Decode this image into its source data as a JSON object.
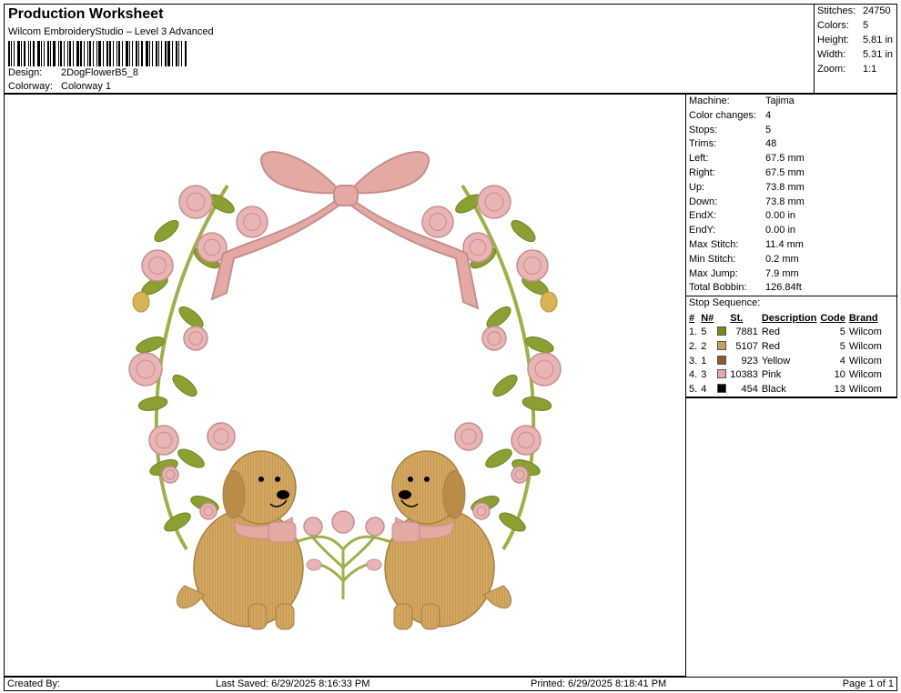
{
  "header": {
    "title": "Production Worksheet",
    "software": "Wilcom EmbroideryStudio – Level 3 Advanced",
    "design_label": "Design:",
    "design_value": "2DogFlowerB5_8",
    "colorway_label": "Colorway:",
    "colorway_value": "Colorway 1"
  },
  "stats": [
    {
      "label": "Stitches:",
      "value": "24750"
    },
    {
      "label": "Colors:",
      "value": "5"
    },
    {
      "label": "Height:",
      "value": "5.81 in"
    },
    {
      "label": "Width:",
      "value": "5.31 in"
    },
    {
      "label": "Zoom:",
      "value": "1:1"
    }
  ],
  "machine_info": [
    {
      "label": "Machine:",
      "value": "Tajima"
    },
    {
      "label": "Color changes:",
      "value": "4"
    },
    {
      "label": "Stops:",
      "value": "5"
    },
    {
      "label": "Trims:",
      "value": "48"
    },
    {
      "label": "Left:",
      "value": "67.5 mm"
    },
    {
      "label": "Right:",
      "value": "67.5 mm"
    },
    {
      "label": "Up:",
      "value": "73.8 mm"
    },
    {
      "label": "Down:",
      "value": "73.8 mm"
    },
    {
      "label": "EndX:",
      "value": "0.00 in"
    },
    {
      "label": "EndY:",
      "value": "0.00 in"
    },
    {
      "label": "Max Stitch:",
      "value": "11.4 mm"
    },
    {
      "label": "Min Stitch:",
      "value": "0.2 mm"
    },
    {
      "label": "Max Jump:",
      "value": "7.9 mm"
    },
    {
      "label": "Total Bobbin:",
      "value": "126.84ft"
    }
  ],
  "stop_sequence": {
    "title": "Stop Sequence:",
    "columns": [
      "#",
      "N#",
      "St.",
      "Description",
      "Code",
      "Brand"
    ],
    "rows": [
      {
        "idx": "1.",
        "n": "5",
        "color": "#7a8a10",
        "st": "7881",
        "desc": "Red",
        "code": "5",
        "brand": "Wilcom"
      },
      {
        "idx": "2.",
        "n": "2",
        "color": "#c9a060",
        "st": "5107",
        "desc": "Red",
        "code": "5",
        "brand": "Wilcom"
      },
      {
        "idx": "3.",
        "n": "1",
        "color": "#8b5a2b",
        "st": "923",
        "desc": "Yellow",
        "code": "4",
        "brand": "Wilcom"
      },
      {
        "idx": "4.",
        "n": "3",
        "color": "#e8a8b0",
        "st": "10383",
        "desc": "Pink",
        "code": "10",
        "brand": "Wilcom"
      },
      {
        "idx": "5.",
        "n": "4",
        "color": "#000000",
        "st": "454",
        "desc": "Black",
        "code": "13",
        "brand": "Wilcom"
      }
    ]
  },
  "footer": {
    "created_by": "Created By:",
    "last_saved": "Last Saved: 6/29/2025 8:16:33 PM",
    "printed": "Printed: 6/29/2025 8:18:41 PM",
    "page": "Page 1 of 1"
  },
  "colors": {
    "leaf": "#8aa032",
    "leaf_dark": "#6e8424",
    "stem": "#9fb04a",
    "rose": "#e8b4b4",
    "rose_dark": "#c98d8d",
    "bud_yellow": "#d8b454",
    "ribbon": "#e3a9a3",
    "dog": "#d2a760",
    "dog_dark": "#a9803f"
  }
}
